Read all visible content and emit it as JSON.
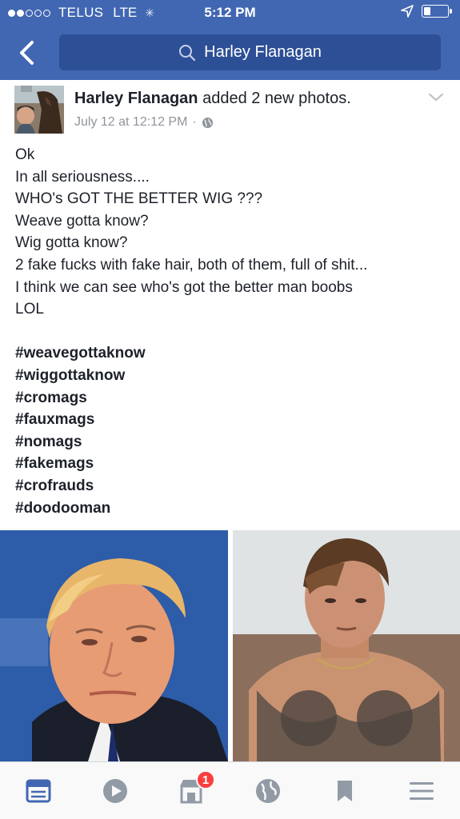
{
  "status_bar": {
    "carrier": "TELUS",
    "network": "LTE",
    "time": "5:12 PM",
    "signal_bars_filled": 2,
    "signal_bars_total": 5
  },
  "nav": {
    "search_text": "Harley Flanagan",
    "back_icon": "chevron-left-icon",
    "search_icon": "search-icon"
  },
  "post": {
    "author": "Harley Flanagan",
    "action": "added 2 new photos.",
    "timestamp": "July 12 at 12:12 PM",
    "separator": "·",
    "privacy_icon": "globe-icon",
    "lines": [
      "Ok",
      "In all seriousness....",
      "WHO's GOT THE BETTER WIG ???",
      "Weave gotta know?",
      "Wig gotta know?",
      "2 fake fucks with fake hair, both of them, full of shit...",
      "I think we can see who's got the better man boobs",
      "LOL"
    ],
    "hashtags": [
      "#weavegottaknow",
      "#wiggottaknow",
      "#cromags",
      "#fauxmags",
      "#nomags",
      "#fakemags",
      "#crofrauds",
      "#doodooman"
    ]
  },
  "tabbar": {
    "tabs": [
      {
        "name": "news-feed",
        "icon": "news-feed-icon",
        "active": true
      },
      {
        "name": "video",
        "icon": "video-play-icon",
        "active": false
      },
      {
        "name": "marketplace",
        "icon": "marketplace-icon",
        "active": false,
        "badge": "1"
      },
      {
        "name": "notifications",
        "icon": "globe-icon",
        "active": false
      },
      {
        "name": "saved",
        "icon": "bookmark-icon",
        "active": false
      },
      {
        "name": "menu",
        "icon": "menu-icon",
        "active": false
      }
    ]
  },
  "colors": {
    "brand_blue": "#4267b2",
    "search_bg": "#2d4f96",
    "active_tab": "#4267b2",
    "inactive_tab": "#929aa6",
    "badge": "#fa3e3e"
  }
}
